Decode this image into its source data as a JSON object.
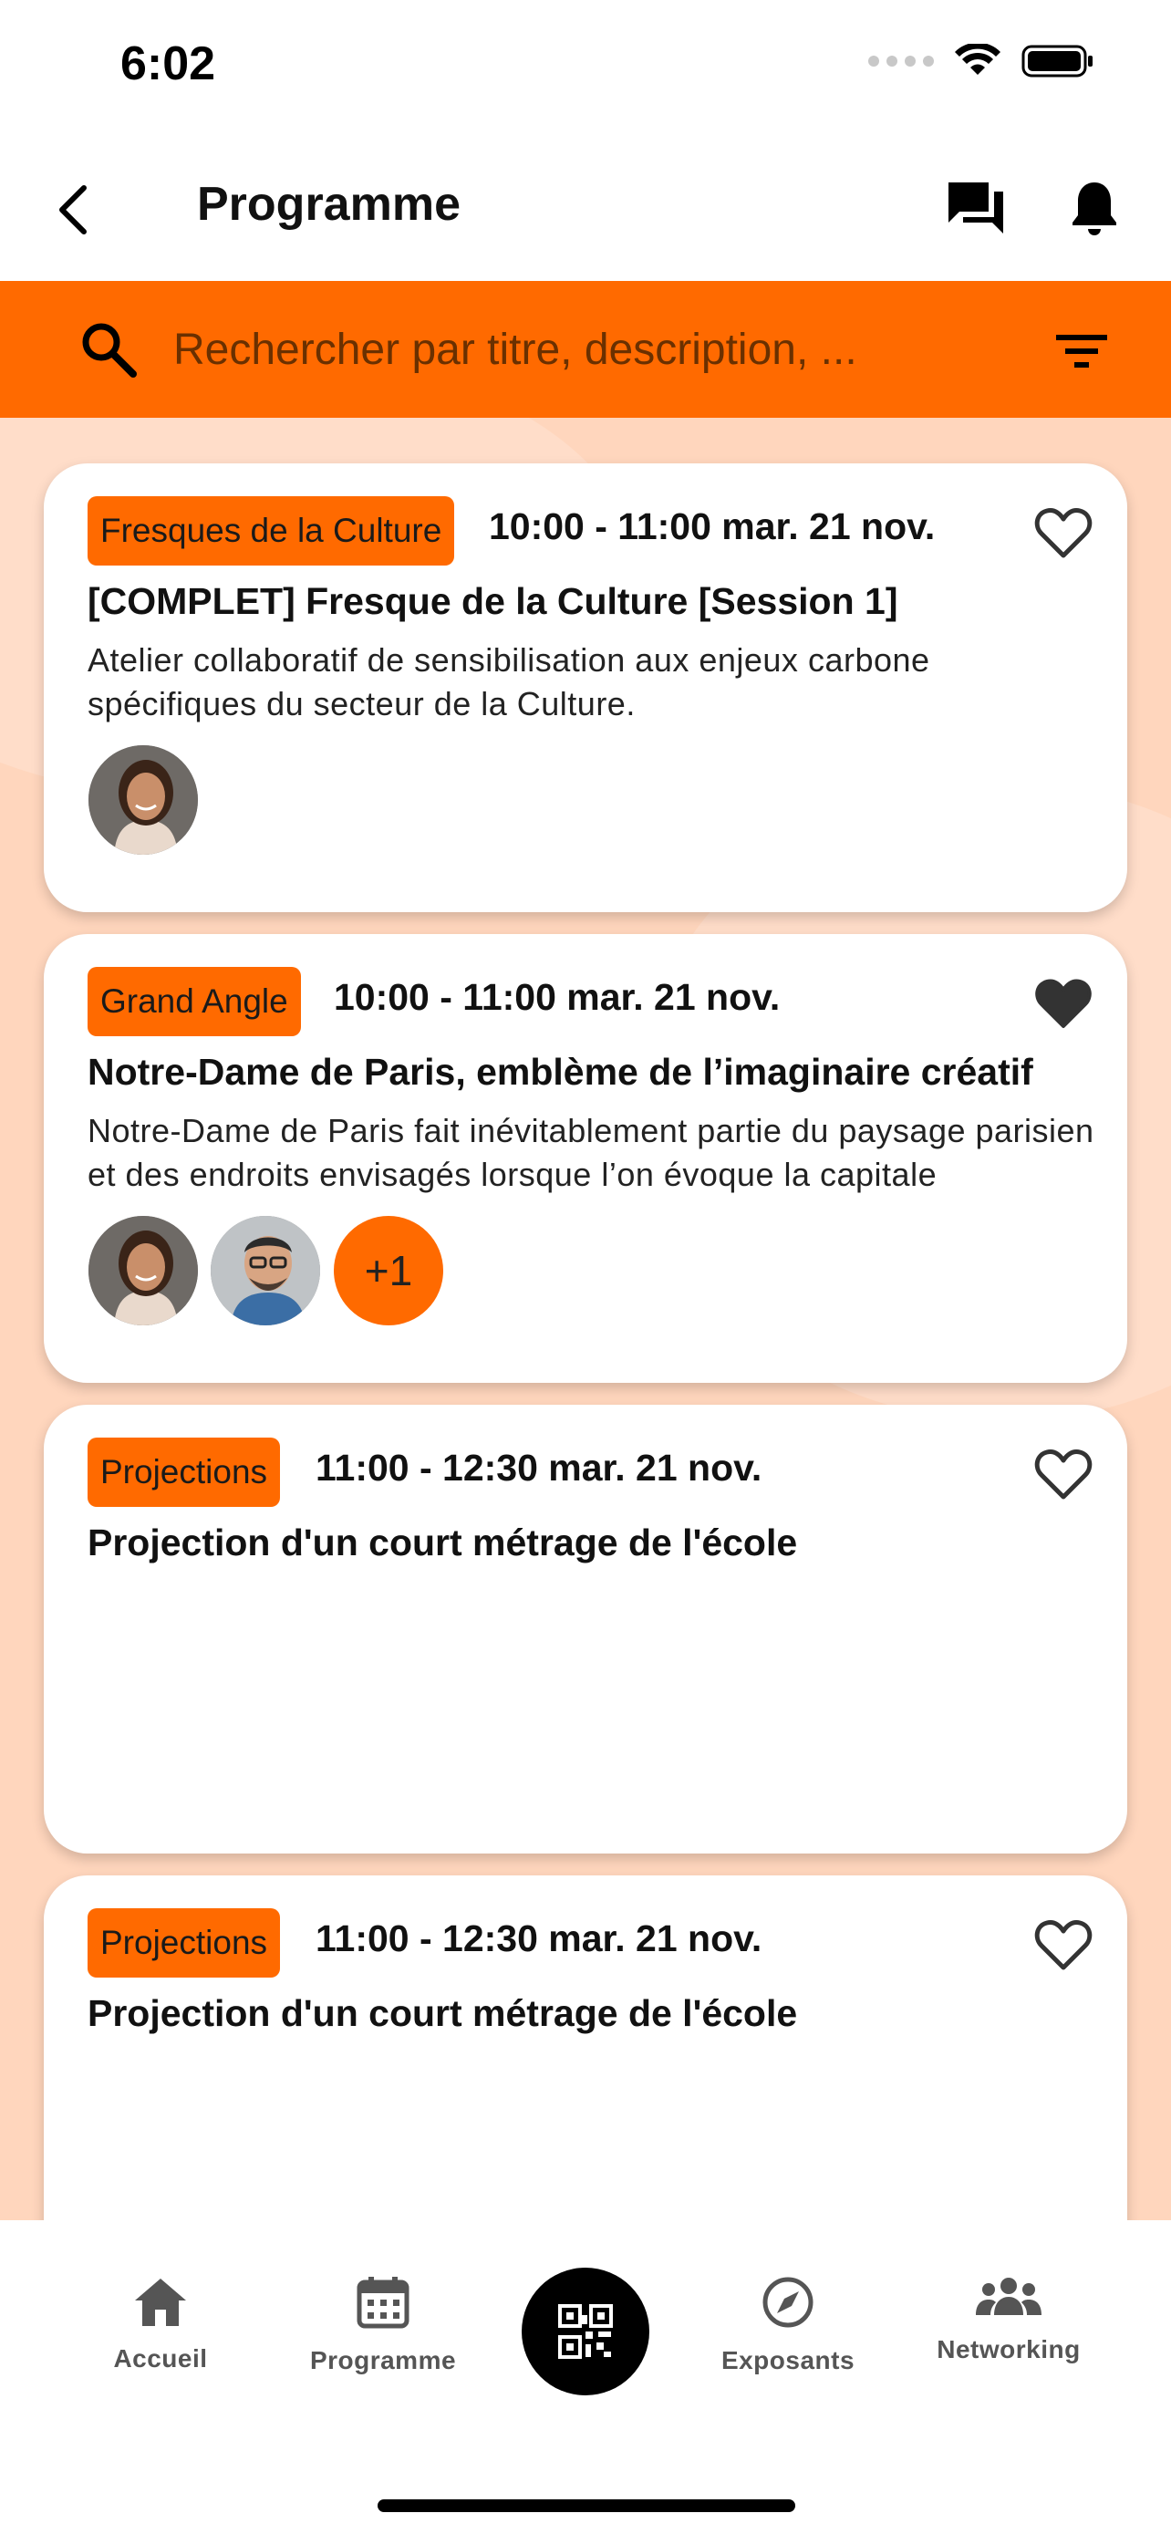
{
  "status_bar": {
    "time": "6:02"
  },
  "header": {
    "title": "Programme"
  },
  "search": {
    "placeholder": "Rechercher par titre, description, ..."
  },
  "colors": {
    "accent": "#ff6a00",
    "background": "#ffd6bd",
    "text": "#111111"
  },
  "events": [
    {
      "category": "Fresques de la Culture",
      "time": "10:00 - 11:00 mar. 21 nov.",
      "title": "[COMPLET] Fresque de la Culture [Session 1]",
      "description": "Atelier collaboratif de sensibilisation aux enjeux carbone spécifiques du secteur de la Culture.",
      "favorite": false,
      "speakers": [
        "woman-avatar"
      ],
      "more_speakers": ""
    },
    {
      "category": "Grand Angle",
      "time": "10:00 - 11:00 mar. 21 nov.",
      "title": "Notre-Dame de Paris, emblème de l’imaginaire créatif",
      "description": "Notre-Dame de Paris fait inévitablement partie du paysage parisien et des endroits envisagés lorsque l’on évoque la capitale",
      "favorite": true,
      "speakers": [
        "woman-avatar",
        "man-avatar"
      ],
      "more_speakers": "+1"
    },
    {
      "category": "Projections",
      "time": "11:00 - 12:30 mar. 21 nov.",
      "title": "Projection d'un court métrage de l'école",
      "description": "",
      "favorite": false,
      "speakers": [],
      "more_speakers": ""
    },
    {
      "category": "Projections",
      "time": "11:00 - 12:30 mar. 21 nov.",
      "title": "Projection d'un court métrage de l'école",
      "description": "",
      "favorite": false,
      "speakers": [],
      "more_speakers": ""
    }
  ],
  "tabbar": {
    "items": [
      {
        "label": "Accueil",
        "icon": "home-icon"
      },
      {
        "label": "Programme",
        "icon": "calendar-icon"
      },
      {
        "label": "",
        "icon": "qr-code-icon"
      },
      {
        "label": "Exposants",
        "icon": "compass-icon"
      },
      {
        "label": "Networking",
        "icon": "people-icon"
      }
    ]
  }
}
